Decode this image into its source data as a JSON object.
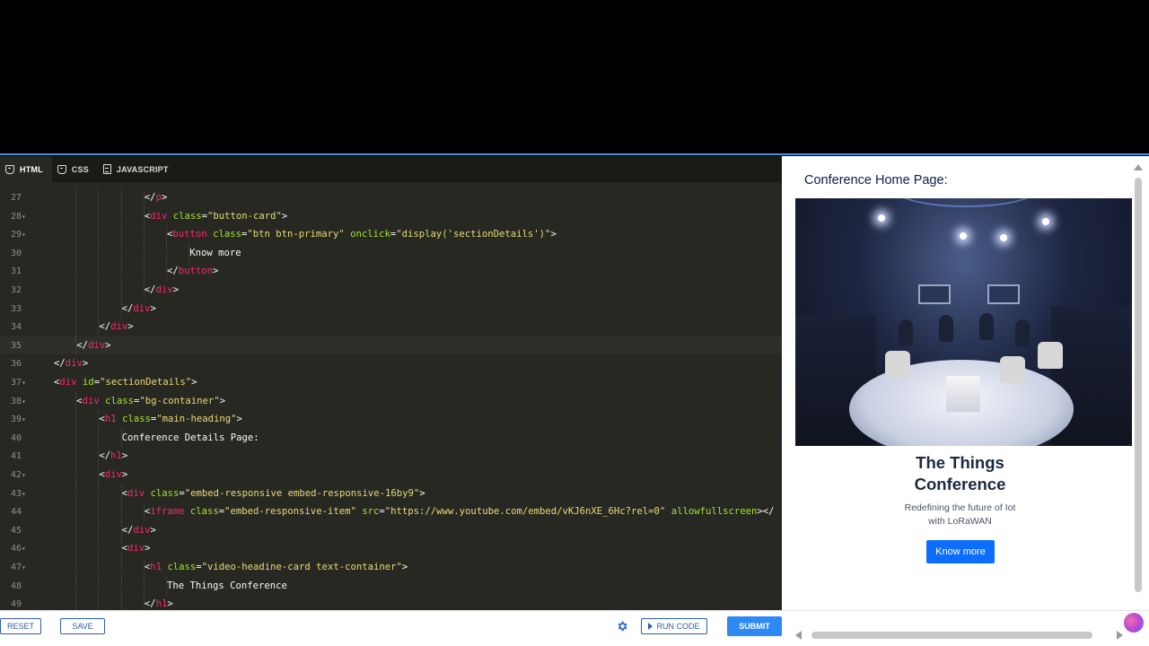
{
  "editor": {
    "tabs": [
      {
        "label": "HTML",
        "icon": "html5-icon",
        "active": true
      },
      {
        "label": "CSS",
        "icon": "css3-icon",
        "active": false
      },
      {
        "label": "JAVASCRIPT",
        "icon": "file-icon",
        "active": false
      }
    ],
    "partial_line_text": "Redefining the future of IoT with LoRaWAN",
    "lines": [
      {
        "n": "27",
        "fold": "",
        "indent": 5,
        "tokens": [
          [
            "tg",
            "</"
          ],
          [
            "tn",
            "p"
          ],
          [
            "tg",
            ">"
          ]
        ]
      },
      {
        "n": "28",
        "fold": "▾",
        "indent": 5,
        "tokens": [
          [
            "tg",
            "<"
          ],
          [
            "tn",
            "div"
          ],
          [
            "pl",
            " "
          ],
          [
            "at",
            "class"
          ],
          [
            "pl",
            "="
          ],
          [
            "st",
            "\"button-card\""
          ],
          [
            "tg",
            ">"
          ]
        ]
      },
      {
        "n": "29",
        "fold": "▾",
        "indent": 6,
        "tokens": [
          [
            "tg",
            "<"
          ],
          [
            "tn",
            "button"
          ],
          [
            "pl",
            " "
          ],
          [
            "at",
            "class"
          ],
          [
            "pl",
            "="
          ],
          [
            "st",
            "\"btn btn-primary\""
          ],
          [
            "pl",
            " "
          ],
          [
            "at",
            "onclick"
          ],
          [
            "pl",
            "="
          ],
          [
            "st",
            "\"display('sectionDetails')\""
          ],
          [
            "tg",
            ">"
          ]
        ]
      },
      {
        "n": "30",
        "fold": "",
        "indent": 7,
        "tokens": [
          [
            "pl",
            "Know more"
          ]
        ]
      },
      {
        "n": "31",
        "fold": "",
        "indent": 6,
        "tokens": [
          [
            "tg",
            "</"
          ],
          [
            "tn",
            "button"
          ],
          [
            "tg",
            ">"
          ]
        ]
      },
      {
        "n": "32",
        "fold": "",
        "indent": 5,
        "tokens": [
          [
            "tg",
            "</"
          ],
          [
            "tn",
            "div"
          ],
          [
            "tg",
            ">"
          ]
        ]
      },
      {
        "n": "33",
        "fold": "",
        "indent": 4,
        "tokens": [
          [
            "tg",
            "</"
          ],
          [
            "tn",
            "div"
          ],
          [
            "tg",
            ">"
          ]
        ]
      },
      {
        "n": "34",
        "fold": "",
        "indent": 3,
        "tokens": [
          [
            "tg",
            "</"
          ],
          [
            "tn",
            "div"
          ],
          [
            "tg",
            ">"
          ]
        ]
      },
      {
        "n": "35",
        "fold": "",
        "indent": 2,
        "hl": true,
        "tokens": [
          [
            "tg",
            "</"
          ],
          [
            "tn",
            "div"
          ],
          [
            "tg",
            ">"
          ]
        ]
      },
      {
        "n": "36",
        "fold": "",
        "indent": 1,
        "tokens": [
          [
            "tg",
            "</"
          ],
          [
            "tn",
            "div"
          ],
          [
            "tg",
            ">"
          ]
        ]
      },
      {
        "n": "37",
        "fold": "▾",
        "indent": 1,
        "tokens": [
          [
            "tg",
            "<"
          ],
          [
            "tn",
            "div"
          ],
          [
            "pl",
            " "
          ],
          [
            "at",
            "id"
          ],
          [
            "pl",
            "="
          ],
          [
            "st",
            "\"sectionDetails\""
          ],
          [
            "tg",
            ">"
          ]
        ]
      },
      {
        "n": "38",
        "fold": "▾",
        "indent": 2,
        "tokens": [
          [
            "tg",
            "<"
          ],
          [
            "tn",
            "div"
          ],
          [
            "pl",
            " "
          ],
          [
            "at",
            "class"
          ],
          [
            "pl",
            "="
          ],
          [
            "st",
            "\"bg-container\""
          ],
          [
            "tg",
            ">"
          ]
        ]
      },
      {
        "n": "39",
        "fold": "▾",
        "indent": 3,
        "tokens": [
          [
            "tg",
            "<"
          ],
          [
            "tn",
            "h1"
          ],
          [
            "pl",
            " "
          ],
          [
            "at",
            "class"
          ],
          [
            "pl",
            "="
          ],
          [
            "st",
            "\"main-heading\""
          ],
          [
            "tg",
            ">"
          ]
        ]
      },
      {
        "n": "40",
        "fold": "",
        "indent": 4,
        "tokens": [
          [
            "pl",
            "Conference Details Page:"
          ]
        ]
      },
      {
        "n": "41",
        "fold": "",
        "indent": 3,
        "tokens": [
          [
            "tg",
            "</"
          ],
          [
            "tn",
            "h1"
          ],
          [
            "tg",
            ">"
          ]
        ]
      },
      {
        "n": "42",
        "fold": "▾",
        "indent": 3,
        "tokens": [
          [
            "tg",
            "<"
          ],
          [
            "tn",
            "div"
          ],
          [
            "tg",
            ">"
          ]
        ]
      },
      {
        "n": "43",
        "fold": "▾",
        "indent": 4,
        "tokens": [
          [
            "tg",
            "<"
          ],
          [
            "tn",
            "div"
          ],
          [
            "pl",
            " "
          ],
          [
            "at",
            "class"
          ],
          [
            "pl",
            "="
          ],
          [
            "st",
            "\"embed-responsive embed-responsive-16by9\""
          ],
          [
            "tg",
            ">"
          ]
        ]
      },
      {
        "n": "44",
        "fold": "",
        "indent": 5,
        "tokens": [
          [
            "tg",
            "<"
          ],
          [
            "tn",
            "iframe"
          ],
          [
            "pl",
            " "
          ],
          [
            "at",
            "class"
          ],
          [
            "pl",
            "="
          ],
          [
            "st",
            "\"embed-responsive-item\""
          ],
          [
            "pl",
            " "
          ],
          [
            "at",
            "src"
          ],
          [
            "pl",
            "="
          ],
          [
            "st",
            "\"https://www.youtube.com/embed/vKJ6nXE_6Hc?rel=0\""
          ],
          [
            "pl",
            " "
          ],
          [
            "at",
            "allowfullscreen"
          ],
          [
            "tg",
            "></"
          ]
        ]
      },
      {
        "n": "45",
        "fold": "",
        "indent": 4,
        "tokens": [
          [
            "tg",
            "</"
          ],
          [
            "tn",
            "div"
          ],
          [
            "tg",
            ">"
          ]
        ]
      },
      {
        "n": "46",
        "fold": "▾",
        "indent": 4,
        "tokens": [
          [
            "tg",
            "<"
          ],
          [
            "tn",
            "div"
          ],
          [
            "tg",
            ">"
          ]
        ]
      },
      {
        "n": "47",
        "fold": "▾",
        "indent": 5,
        "tokens": [
          [
            "tg",
            "<"
          ],
          [
            "tn",
            "h1"
          ],
          [
            "pl",
            " "
          ],
          [
            "at",
            "class"
          ],
          [
            "pl",
            "="
          ],
          [
            "st",
            "\"video-headine-card text-container\""
          ],
          [
            "tg",
            ">"
          ]
        ]
      },
      {
        "n": "48",
        "fold": "",
        "indent": 6,
        "tokens": [
          [
            "pl",
            "The Things Conference"
          ]
        ]
      },
      {
        "n": "49",
        "fold": "",
        "indent": 5,
        "tokens": [
          [
            "tg",
            "</"
          ],
          [
            "tn",
            "h1"
          ],
          [
            "tg",
            ">"
          ]
        ]
      }
    ]
  },
  "preview": {
    "heading": "Conference Home Page:",
    "hero_alt": "conference panel stage photo",
    "card_title_line1": "The Things",
    "card_title_line2": "Conference",
    "card_sub_line1": "Redefining the future of Iot",
    "card_sub_line2": "with LoRaWAN",
    "button_label": "Know more"
  },
  "toolbar": {
    "reset_label": "RESET",
    "save_label": "SAVE",
    "settings_icon": "gear-icon",
    "run_label": "RUN CODE",
    "submit_label": "SUBMIT"
  },
  "colors": {
    "editor_bg": "#272822",
    "tag": "#f92672",
    "attr": "#a6e22e",
    "string": "#e6db74",
    "accent": "#2f89f5",
    "primary_button": "#0d6efd"
  }
}
